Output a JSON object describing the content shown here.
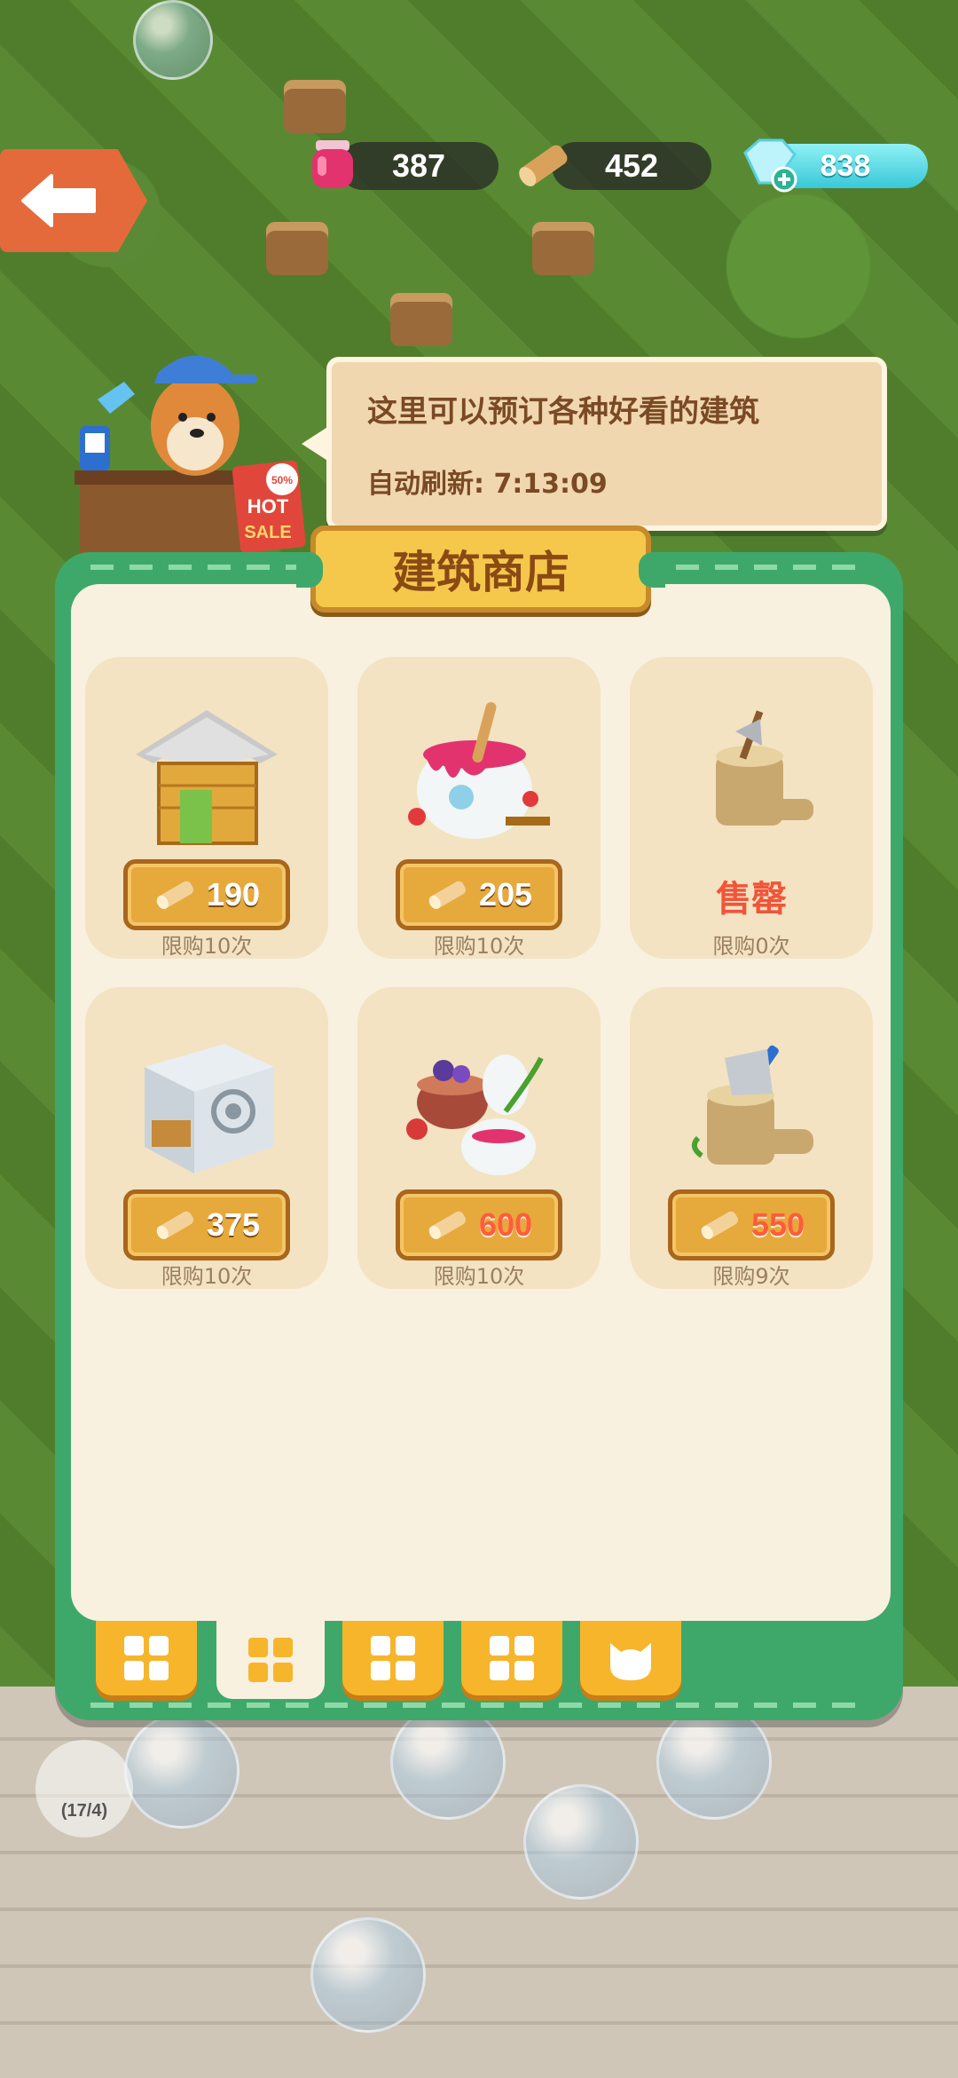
{
  "header": {
    "resources": [
      {
        "icon": "jam-jar-icon",
        "value": "387"
      },
      {
        "icon": "wood-log-icon",
        "value": "452"
      }
    ],
    "gems": {
      "icon": "gem-icon",
      "value": "838"
    }
  },
  "shopkeeper": {
    "message": "这里可以预订各种好看的建筑",
    "refresh_label": "自动刷新: 7:13:09",
    "sale_sign": {
      "discount": "50% OFF",
      "text": "HOT SALE"
    }
  },
  "shop": {
    "title": "建筑商店",
    "items": [
      {
        "name": "wooden-house",
        "price": "190",
        "price_color": "white",
        "limit": "限购10次",
        "sold_out": false
      },
      {
        "name": "jam-pot",
        "price": "205",
        "price_color": "white",
        "limit": "限购10次",
        "sold_out": false
      },
      {
        "name": "axe-stump",
        "sold_out_label": "售罄",
        "limit": "限购0次",
        "sold_out": true
      },
      {
        "name": "metal-oven",
        "price": "375",
        "price_color": "white",
        "limit": "限购10次",
        "sold_out": false
      },
      {
        "name": "berry-jars",
        "price": "600",
        "price_color": "red",
        "limit": "限购10次",
        "sold_out": false
      },
      {
        "name": "cleaver-stump",
        "price": "550",
        "price_color": "red",
        "limit": "限购9次",
        "sold_out": false
      }
    ]
  },
  "tabs": [
    {
      "icon": "grid-icon",
      "active": false
    },
    {
      "icon": "grid-icon",
      "active": true
    },
    {
      "icon": "grid-icon",
      "active": false
    },
    {
      "icon": "grid-icon",
      "active": false
    },
    {
      "icon": "cat-face-icon",
      "active": false
    }
  ],
  "world": {
    "counter_badge": "(17/4)"
  },
  "colors": {
    "panel_green": "#3ea86a",
    "panel_cream": "#f8f1e0",
    "price_gold": "#e6a93c",
    "sold_out_red": "#f0553a"
  }
}
